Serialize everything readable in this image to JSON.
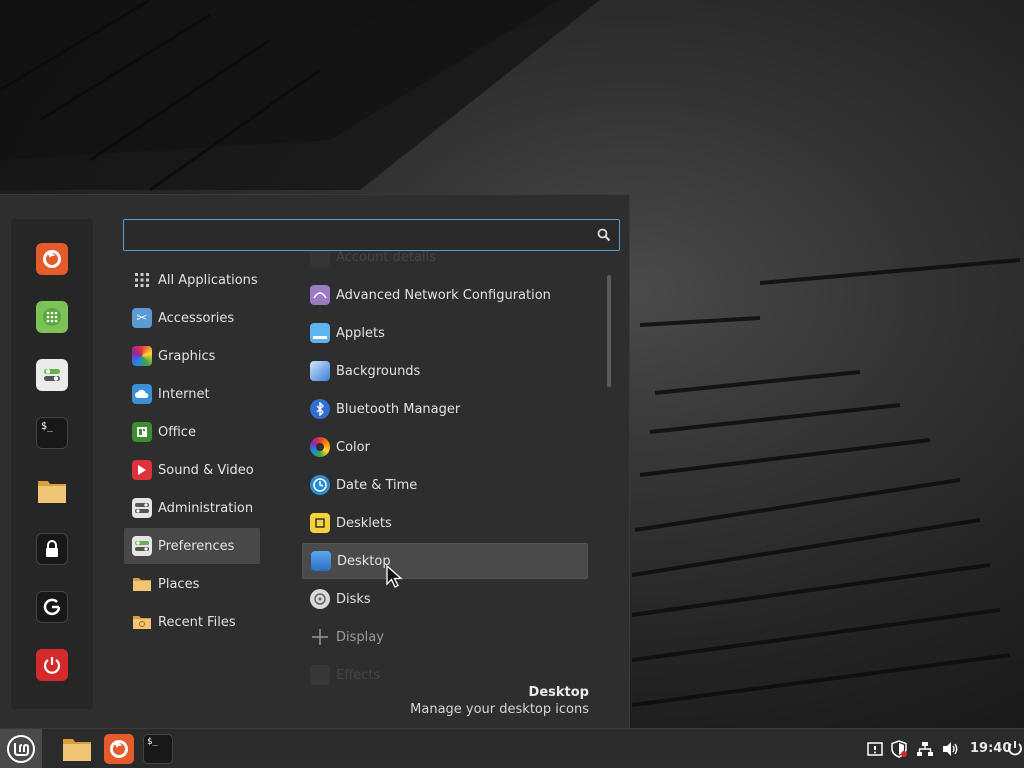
{
  "menu": {
    "search": {
      "value": "",
      "placeholder": ""
    },
    "favorites": [
      {
        "name": "firefox-icon",
        "color": "#e55c2c"
      },
      {
        "name": "software-manager-icon",
        "color": "#7cc259"
      },
      {
        "name": "settings-icon",
        "color": "#e9e9e9"
      },
      {
        "name": "terminal-icon",
        "color": "#1a1a1a"
      },
      {
        "name": "files-icon",
        "color": "#e8b35a"
      },
      {
        "name": "lock-icon",
        "color": "#1a1a1a"
      },
      {
        "name": "logout-icon",
        "color": "#1a1a1a"
      },
      {
        "name": "power-icon",
        "color": "#d42a2a"
      }
    ],
    "categories": [
      {
        "label": "All Applications"
      },
      {
        "label": "Accessories"
      },
      {
        "label": "Graphics"
      },
      {
        "label": "Internet"
      },
      {
        "label": "Office"
      },
      {
        "label": "Sound & Video"
      },
      {
        "label": "Administration"
      },
      {
        "label": "Preferences"
      },
      {
        "label": "Places"
      },
      {
        "label": "Recent Files"
      }
    ],
    "selected_category": "Preferences",
    "apps": [
      {
        "label": "Account details"
      },
      {
        "label": "Advanced Network Configuration"
      },
      {
        "label": "Applets"
      },
      {
        "label": "Backgrounds"
      },
      {
        "label": "Bluetooth Manager"
      },
      {
        "label": "Color"
      },
      {
        "label": "Date & Time"
      },
      {
        "label": "Desklets"
      },
      {
        "label": "Desktop"
      },
      {
        "label": "Disks"
      },
      {
        "label": "Display"
      },
      {
        "label": "Effects"
      }
    ],
    "selected_app": "Desktop",
    "description": {
      "title": "Desktop",
      "text": "Manage your desktop icons"
    }
  },
  "panel": {
    "clock": "19:40",
    "launchers": [
      "files-icon",
      "firefox-icon",
      "terminal-icon"
    ],
    "tray": [
      "update-manager-icon",
      "shield-icon",
      "network-icon",
      "volume-icon"
    ]
  },
  "colors": {
    "accent": "#4e9fd4",
    "menu_bg": "#2e2e2e",
    "panel_bg": "#2b2b2b"
  }
}
